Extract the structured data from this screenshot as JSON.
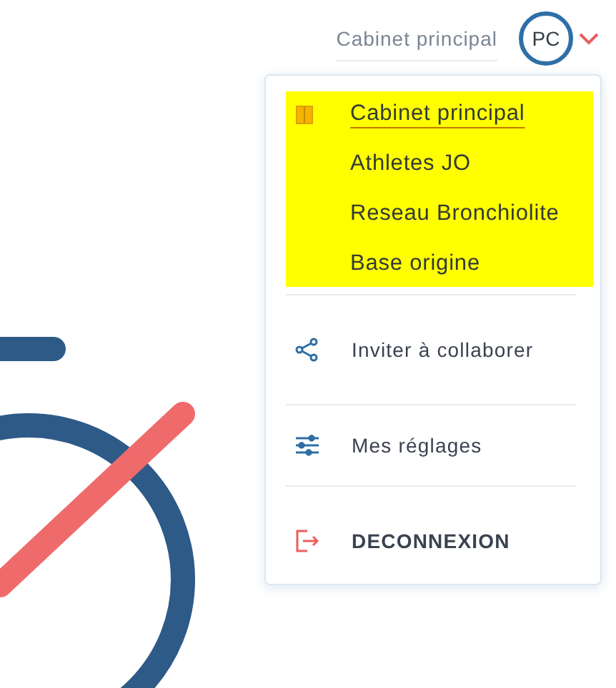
{
  "header": {
    "workspace": "Cabinet principal",
    "avatar_initials": "PC"
  },
  "menu": {
    "workspaces": [
      {
        "label": "Cabinet principal",
        "selected": true
      },
      {
        "label": "Athletes JO",
        "selected": false
      },
      {
        "label": "Reseau Bronchiolite",
        "selected": false
      },
      {
        "label": "Base origine",
        "selected": false
      }
    ],
    "actions": [
      {
        "label": "Inviter à collaborer",
        "kind": "share"
      },
      {
        "label": "Mes réglages",
        "kind": "settings"
      },
      {
        "label": "DECONNEXION",
        "kind": "logout"
      }
    ]
  }
}
